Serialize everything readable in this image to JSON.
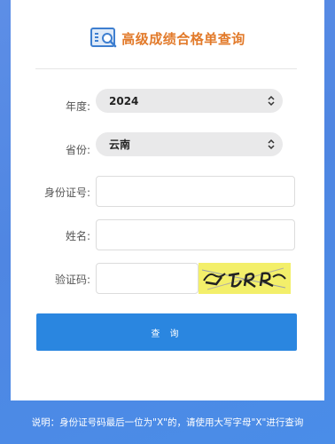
{
  "header": {
    "title": "高级成绩合格单查询",
    "icon": "search-document-icon",
    "accent": "#e27a2a"
  },
  "form": {
    "year": {
      "label": "年度:",
      "value": "2024"
    },
    "province": {
      "label": "省份:",
      "value": "云南"
    },
    "id_number": {
      "label": "身份证号:",
      "value": ""
    },
    "name": {
      "label": "姓名:",
      "value": ""
    },
    "captcha": {
      "label": "验证码:",
      "value": "",
      "image_text": "4TRR"
    }
  },
  "query_button": {
    "label": "查 询",
    "color": "#2a86e0"
  },
  "footer": {
    "note": "说明：身份证号码最后一位为\"X\"的，请使用大写字母\"X\"进行查询"
  }
}
